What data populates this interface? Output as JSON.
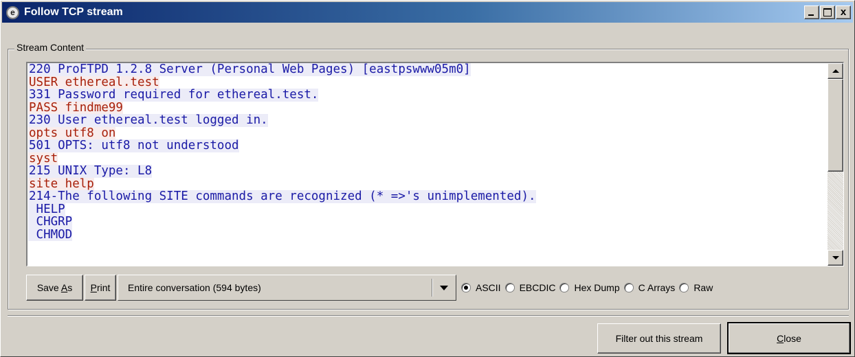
{
  "window": {
    "title": "Follow TCP stream",
    "close_glyph": "x",
    "icon_letter": "e"
  },
  "group": {
    "label": "Stream Content"
  },
  "stream": {
    "lines": [
      {
        "text": "220 ProFTPD 1.2.8 Server (Personal Web Pages) [eastpswww05m0]",
        "role": "server"
      },
      {
        "text": "USER ethereal.test",
        "role": "client"
      },
      {
        "text": "331 Password required for ethereal.test.",
        "role": "server"
      },
      {
        "text": "PASS findme99",
        "role": "client"
      },
      {
        "text": "230 User ethereal.test logged in.",
        "role": "server"
      },
      {
        "text": "opts utf8 on",
        "role": "client"
      },
      {
        "text": "501 OPTS: utf8 not understood",
        "role": "server"
      },
      {
        "text": "syst",
        "role": "client"
      },
      {
        "text": "215 UNIX Type: L8",
        "role": "server"
      },
      {
        "text": "site help",
        "role": "client"
      },
      {
        "text": "214-The following SITE commands are recognized (* =>'s unimplemented).",
        "role": "server"
      },
      {
        "text": " HELP",
        "role": "server"
      },
      {
        "text": " CHGRP",
        "role": "server"
      },
      {
        "text": " CHMOD",
        "role": "server"
      }
    ]
  },
  "toolbar": {
    "save_as_pre": "Save ",
    "save_as_u": "A",
    "save_as_post": "s",
    "print_u": "P",
    "print_post": "rint",
    "conversation_selected": "Entire conversation (594 bytes)"
  },
  "format_options": [
    {
      "label": "ASCII",
      "checked": true
    },
    {
      "label": "EBCDIC",
      "checked": false
    },
    {
      "label": "Hex Dump",
      "checked": false
    },
    {
      "label": "C Arrays",
      "checked": false
    },
    {
      "label": "Raw",
      "checked": false
    }
  ],
  "footer": {
    "filter_label": "Filter out this stream",
    "close_u": "C",
    "close_post": "lose"
  },
  "colors": {
    "server_text": "#1a1aa6",
    "server_bg": "#ececf8",
    "client_text": "#a8200a",
    "client_bg": "#f8ecec",
    "titlebar": "#0a246a"
  }
}
